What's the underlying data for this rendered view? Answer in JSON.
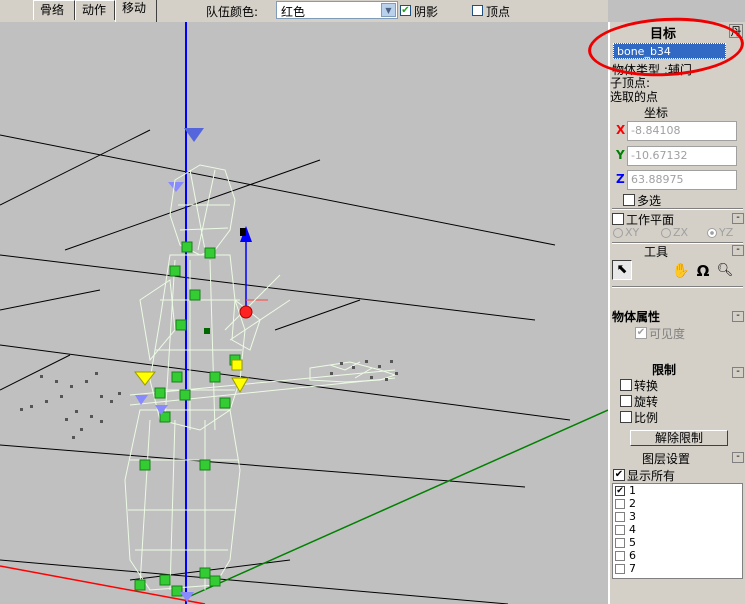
{
  "toolbar": {
    "tabs": [
      "骨络",
      "动作",
      "移动"
    ],
    "team_color_label": "队伍颜色:",
    "team_color_value": "红色",
    "shadow_label": "阴影",
    "vertex_label": "顶点"
  },
  "panel": {
    "target_title": "目标",
    "target_close": "丹",
    "target_value": "bone_b34",
    "object_type": "物体类型 :辅门",
    "child_vertex": "子顶点:",
    "selected_points": "选取的点",
    "coord_title": "坐标",
    "x_label": "X",
    "y_label": "Y",
    "z_label": "Z",
    "x_value": "-8.84108",
    "y_value": "-10.67132",
    "z_value": "63.88975",
    "multi_select": "多选",
    "work_plane": "工作平面",
    "planes": [
      "XY",
      "ZX",
      "YZ"
    ],
    "tools_title": "工具",
    "object_props_title": "物体属性",
    "visibility": "可见度",
    "limits_title": "限制",
    "limit_items": [
      "转换",
      "旋转",
      "比例"
    ],
    "remove_limits": "解除限制",
    "layer_settings": "图层设置",
    "show_all": "显示所有",
    "layers": [
      "1",
      "2",
      "3",
      "4",
      "5",
      "6",
      "7"
    ]
  },
  "colors": {
    "window_bg": "#d4d0c8",
    "viewport_bg": "#c0c0c0",
    "axis_blue": "#0000ff",
    "axis_red": "#ff0000",
    "axis_green": "#008000",
    "selection_blue": "#316ac5",
    "annotation_red": "#e00000"
  }
}
